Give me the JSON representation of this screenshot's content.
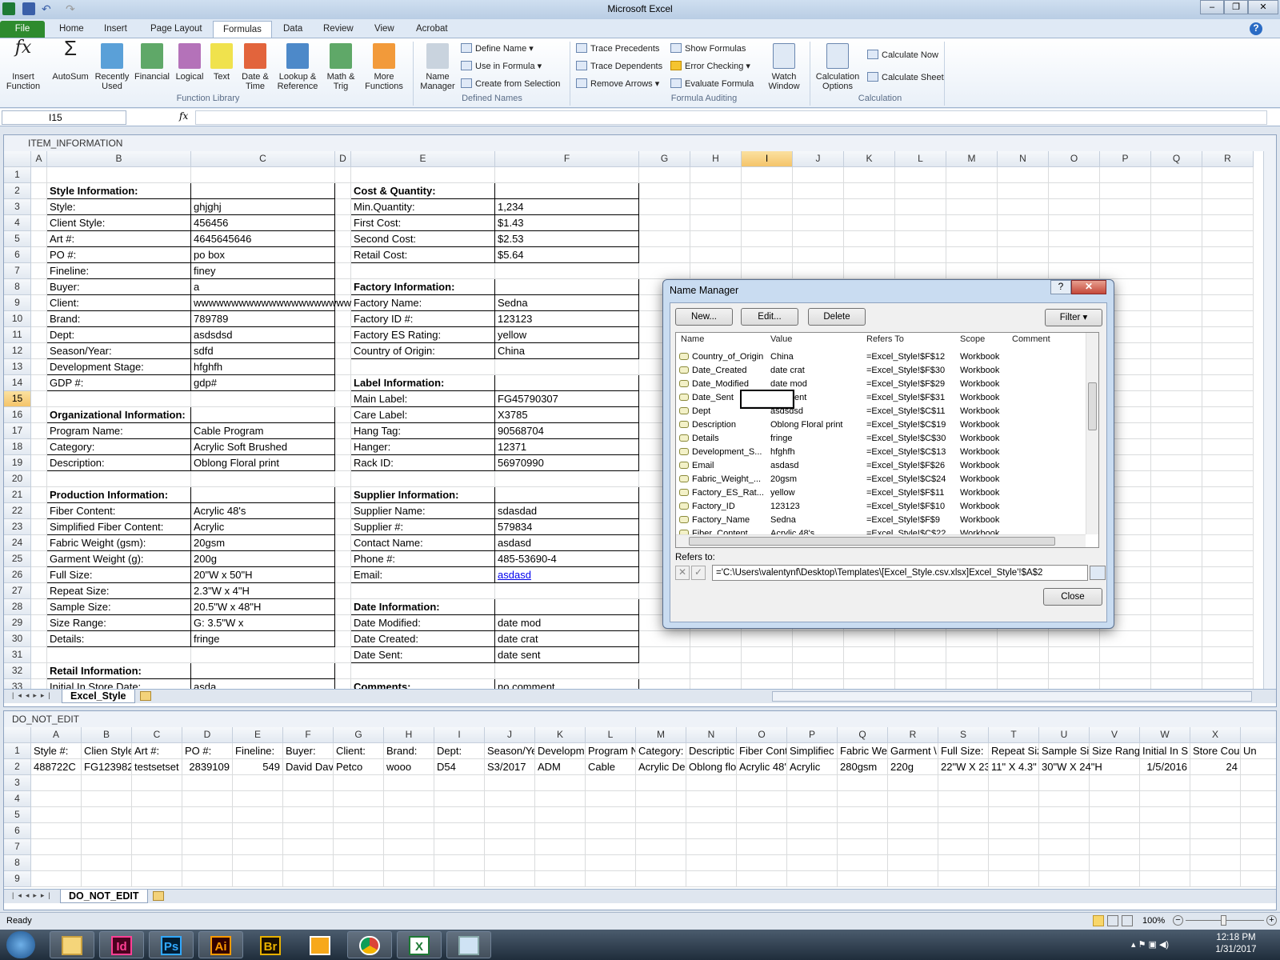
{
  "window": {
    "title": "Microsoft Excel"
  },
  "ribbon": {
    "tabs": [
      "File",
      "Home",
      "Insert",
      "Page Layout",
      "Formulas",
      "Data",
      "Review",
      "View",
      "Acrobat"
    ],
    "active_tab": "Formulas",
    "function_library": {
      "label": "Function Library",
      "buttons": [
        "Insert Function",
        "AutoSum",
        "Recently Used",
        "Financial",
        "Logical",
        "Text",
        "Date & Time",
        "Lookup & Reference",
        "Math & Trig",
        "More Functions"
      ]
    },
    "defined_names": {
      "label": "Defined Names",
      "name_manager": "Name Manager",
      "items": [
        "Define Name",
        "Use in Formula",
        "Create from Selection"
      ]
    },
    "formula_auditing": {
      "label": "Formula Auditing",
      "items": [
        "Trace Precedents",
        "Trace Dependents",
        "Remove Arrows",
        "Show Formulas",
        "Error Checking",
        "Evaluate Formula"
      ],
      "watch": "Watch Window"
    },
    "calculation": {
      "label": "Calculation",
      "options": "Calculation Options",
      "items": [
        "Calculate Now",
        "Calculate Sheet"
      ]
    }
  },
  "formula_bar": {
    "name_box": "I15",
    "fx": "fx",
    "value": ""
  },
  "sheet1": {
    "window_title": "ITEM_INFORMATION",
    "columns": [
      "A",
      "B",
      "C",
      "D",
      "E",
      "F",
      "G",
      "H",
      "I",
      "J",
      "K",
      "L",
      "M",
      "N",
      "O",
      "P",
      "Q",
      "R"
    ],
    "selected_col": "I",
    "selected_row": 15,
    "cells": {
      "2": {
        "B": "Style Information:",
        "E": "Cost & Quantity:"
      },
      "3": {
        "B": "Style:",
        "C": "ghjghj",
        "E": "Min.Quantity:",
        "F": "1,234"
      },
      "4": {
        "B": "Client Style:",
        "C": "456456",
        "E": "First Cost:",
        "F": "$1.43"
      },
      "5": {
        "B": "Art #:",
        "C": "4645645646",
        "E": "Second Cost:",
        "F": "$2.53"
      },
      "6": {
        "B": "PO #:",
        "C": "po box",
        "E": "Retail Cost:",
        "F": "$5.64"
      },
      "7": {
        "B": "Fineline:",
        "C": "finey"
      },
      "8": {
        "B": "Buyer:",
        "C": "a",
        "E": "Factory Information:"
      },
      "9": {
        "B": "Client:",
        "C": "wwwwwwwwwwwwwwwwwwwww",
        "E": "Factory Name:",
        "F": "Sedna"
      },
      "10": {
        "B": "Brand:",
        "C": "789789",
        "E": "Factory ID #:",
        "F": "123123"
      },
      "11": {
        "B": "Dept:",
        "C": "asdsdsd",
        "E": "Factory ES Rating:",
        "F": "yellow"
      },
      "12": {
        "B": "Season/Year:",
        "C": "sdfd",
        "E": "Country of Origin:",
        "F": "China"
      },
      "13": {
        "B": "Development Stage:",
        "C": "hfghfh"
      },
      "14": {
        "B": "GDP #:",
        "C": "gdp#",
        "E": "Label Information:"
      },
      "15": {
        "E": "Main Label:",
        "F": "FG45790307"
      },
      "16": {
        "B": "Organizational Information:",
        "E": "Care Label:",
        "F": "X3785"
      },
      "17": {
        "B": "Program Name:",
        "C": "Cable Program",
        "E": "Hang Tag:",
        "F": "90568704"
      },
      "18": {
        "B": "Category:",
        "C": "Acrylic Soft Brushed",
        "E": "Hanger:",
        "F": "12371"
      },
      "19": {
        "B": "Description:",
        "C": "Oblong Floral print",
        "E": "Rack ID:",
        "F": "56970990"
      },
      "21": {
        "B": "Production Information:",
        "E": "Supplier Information:"
      },
      "22": {
        "B": "Fiber Content:",
        "C": "Acrylic 48's",
        "E": "Supplier Name:",
        "F": "sdasdad"
      },
      "23": {
        "B": "Simplified Fiber Content:",
        "C": "Acrylic",
        "E": "Supplier #:",
        "F": "579834"
      },
      "24": {
        "B": "Fabric Weight (gsm):",
        "C": "20gsm",
        "E": "Contact Name:",
        "F": "asdasd"
      },
      "25": {
        "B": "Garment Weight (g):",
        "C": "200g",
        "E": "Phone #:",
        "F": "485-53690-4"
      },
      "26": {
        "B": "Full Size:",
        "C": "20\"W x 50\"H",
        "E": "Email:",
        "F": "asdasd"
      },
      "27": {
        "B": "Repeat Size:",
        "C": "2.3\"W x 4\"H"
      },
      "28": {
        "B": "Sample Size:",
        "C": "20.5\"W x 48\"H",
        "E": "Date Information:"
      },
      "29": {
        "B": "Size Range:",
        "C": "G: 3.5\"W x",
        "E": "Date Modified:",
        "F": "date mod"
      },
      "30": {
        "B": "Details:",
        "C": "fringe",
        "E": "Date Created:",
        "F": "date crat"
      },
      "31": {
        "E": "Date Sent:",
        "F": "date sent"
      },
      "32": {
        "B": "Retail Information:"
      },
      "33": {
        "B": "Initial In Store Date:",
        "C": "asda",
        "E": "Comments:",
        "F": "no comment"
      }
    },
    "sheet_tab": "Excel_Style"
  },
  "sheet2": {
    "window_title": "DO_NOT_EDIT",
    "columns": [
      "A",
      "B",
      "C",
      "D",
      "E",
      "F",
      "G",
      "H",
      "I",
      "J",
      "K",
      "L",
      "M",
      "N",
      "O",
      "P",
      "Q",
      "R",
      "S",
      "T",
      "U",
      "V",
      "W",
      "X",
      ""
    ],
    "rows": [
      [
        "Style #:",
        "Clien Style",
        "Art #:",
        "PO #:",
        "Fineline:",
        "Buyer:",
        "Client:",
        "Brand:",
        "Dept:",
        "Season/Ye",
        "Developm",
        "Program N",
        "Category:",
        "Descriptic",
        "Fiber Cont",
        "Simplifiec",
        "Fabric We",
        "Garment \\",
        "Full Size:",
        "Repeat Siz",
        "Sample Si",
        "Size Rang",
        "Initial In S",
        "Store Cou",
        "Un"
      ],
      [
        "488722C",
        "FG123982",
        "testsetset",
        "2839109",
        "549",
        "David Dav",
        "Petco",
        "wooo",
        "D54",
        "S3/2017",
        "ADM",
        "Cable",
        "Acrylic De",
        "Oblong flo",
        "Acrylic 48'",
        "Acrylic",
        "280gsm",
        "220g",
        "22\"W X 23",
        "11\" X 4.3\"",
        "30\"W X 24\"H",
        "",
        "1/5/2016",
        "24",
        ""
      ]
    ],
    "row_count": 9,
    "sheet_tab": "DO_NOT_EDIT"
  },
  "name_manager": {
    "title": "Name Manager",
    "buttons": {
      "new": "New...",
      "edit": "Edit...",
      "delete": "Delete",
      "filter": "Filter ▾",
      "close": "Close"
    },
    "headers": [
      "Name",
      "Value",
      "Refers To",
      "Scope",
      "Comment"
    ],
    "rows": [
      [
        "Country_of_Origin",
        "China",
        "=Excel_Style!$F$12",
        "Workbook"
      ],
      [
        "Date_Created",
        "date crat",
        "=Excel_Style!$F$30",
        "Workbook"
      ],
      [
        "Date_Modified",
        "date mod",
        "=Excel_Style!$F$29",
        "Workbook"
      ],
      [
        "Date_Sent",
        "date sent",
        "=Excel_Style!$F$31",
        "Workbook"
      ],
      [
        "Dept",
        "asdsdsd",
        "=Excel_Style!$C$11",
        "Workbook"
      ],
      [
        "Description",
        "Oblong Floral print",
        "=Excel_Style!$C$19",
        "Workbook"
      ],
      [
        "Details",
        "fringe",
        "=Excel_Style!$C$30",
        "Workbook"
      ],
      [
        "Development_S...",
        "hfghfh",
        "=Excel_Style!$C$13",
        "Workbook"
      ],
      [
        "Email",
        "asdasd",
        "=Excel_Style!$F$26",
        "Workbook"
      ],
      [
        "Fabric_Weight_...",
        "20gsm",
        "=Excel_Style!$C$24",
        "Workbook"
      ],
      [
        "Factory_ES_Rat...",
        "yellow",
        "=Excel_Style!$F$11",
        "Workbook"
      ],
      [
        "Factory_ID",
        "123123",
        "=Excel_Style!$F$10",
        "Workbook"
      ],
      [
        "Factory_Name",
        "Sedna",
        "=Excel_Style!$F$9",
        "Workbook"
      ],
      [
        "Fiber_Content",
        "Acrylic 48's",
        "=Excel_Style!$C$22",
        "Workbook"
      ]
    ],
    "refers_to_label": "Refers to:",
    "refers_to_value": "='C:\\Users\\valentynf\\Desktop\\Templates\\[Excel_Style.csv.xlsx]Excel_Style'!$A$2"
  },
  "status": {
    "ready": "Ready",
    "zoom": "100%"
  },
  "taskbar": {
    "apps": [
      "Explorer",
      "Id",
      "Ps",
      "Ai",
      "Br",
      "Outlook",
      "Chrome",
      "Excel",
      "Paint"
    ],
    "time": "12:18 PM",
    "date": "1/31/2017"
  }
}
